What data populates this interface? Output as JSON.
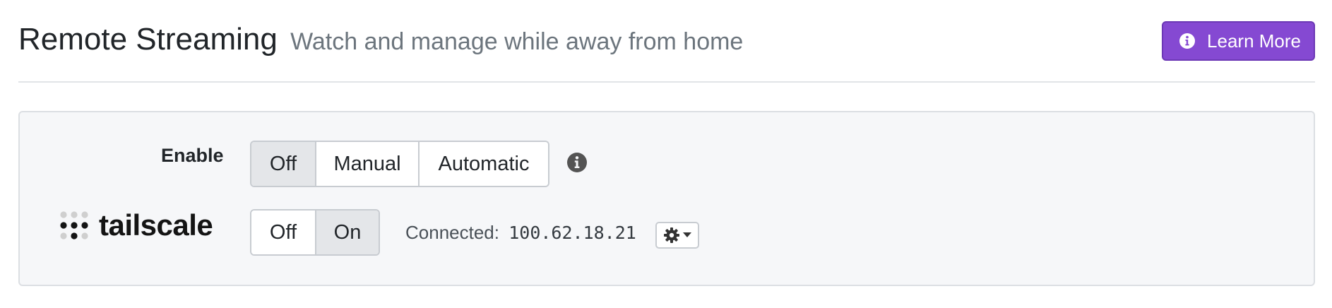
{
  "header": {
    "title": "Remote Streaming",
    "subtitle": "Watch and manage while away from home",
    "learn_more_label": "Learn More",
    "learn_more_icon": "info-circle-icon",
    "accent_color": "#8549d2"
  },
  "enable": {
    "label": "Enable",
    "options": [
      "Off",
      "Manual",
      "Automatic"
    ],
    "selected": "Off",
    "info_icon": "info-circle-icon"
  },
  "tailscale": {
    "logo_text": "tailscale",
    "logo_icon": "tailscale-dots-icon",
    "options": [
      "Off",
      "On"
    ],
    "selected": "On",
    "status_label": "Connected:",
    "ip_address": "100.62.18.21",
    "settings_icon": "gear-icon",
    "dropdown_icon": "caret-down-icon"
  }
}
